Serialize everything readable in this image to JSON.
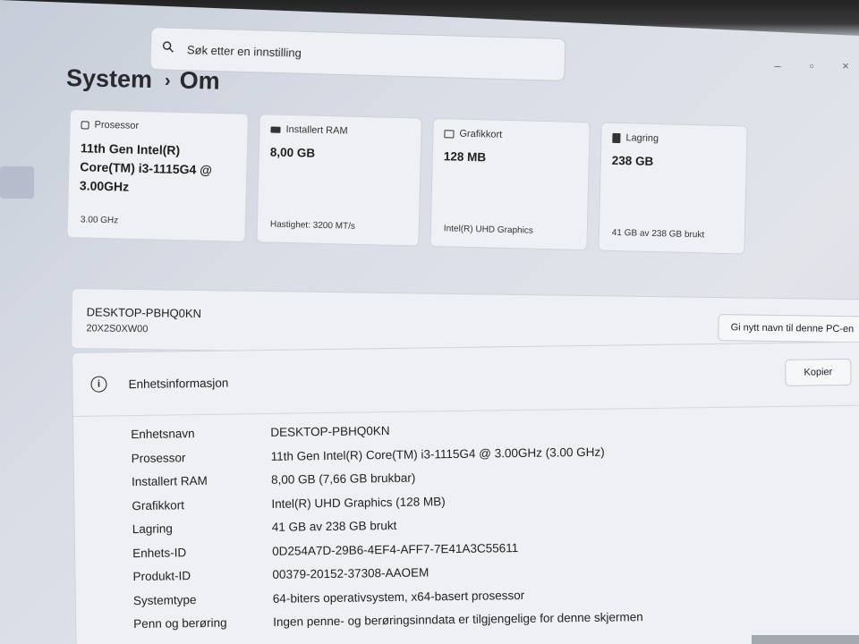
{
  "search": {
    "placeholder": "Søk etter en innstilling"
  },
  "breadcrumb": {
    "root": "System",
    "current": "Om"
  },
  "window_controls": {
    "minimize": "–",
    "maximize": "▫",
    "close": "×"
  },
  "cards": [
    {
      "id": "processor",
      "icon": "processor-icon",
      "label": "Prosessor",
      "value": "11th Gen Intel(R) Core(TM) i3-1115G4 @ 3.00GHz",
      "sub": "3.00 GHz"
    },
    {
      "id": "ram",
      "icon": "ram-icon",
      "label": "Installert RAM",
      "value": "8,00 GB",
      "sub": "Hastighet: 3200 MT/s"
    },
    {
      "id": "gpu",
      "icon": "gpu-icon",
      "label": "Grafikkort",
      "value": "128 MB",
      "sub": "Intel(R) UHD Graphics"
    },
    {
      "id": "storage",
      "icon": "storage-icon",
      "label": "Lagring",
      "value": "238 GB",
      "sub": "41 GB av 238 GB brukt"
    }
  ],
  "pc": {
    "name": "DESKTOP-PBHQ0KN",
    "model": "20X2S0XW00",
    "rename_label": "Gi nytt navn til denne PC-en"
  },
  "device_info": {
    "title": "Enhetsinformasjon",
    "copy_label": "Kopier",
    "rows": [
      {
        "key": "Enhetsnavn",
        "value": "DESKTOP-PBHQ0KN"
      },
      {
        "key": "Prosessor",
        "value": "11th Gen Intel(R) Core(TM) i3-1115G4 @ 3.00GHz (3.00 GHz)"
      },
      {
        "key": "Installert RAM",
        "value": "8,00 GB (7,66 GB brukbar)"
      },
      {
        "key": "Grafikkort",
        "value": "Intel(R) UHD Graphics (128 MB)"
      },
      {
        "key": "Lagring",
        "value": "41 GB av 238 GB brukt"
      },
      {
        "key": "Enhets-ID",
        "value": "0D254A7D-29B6-4EF4-AFF7-7E41A3C55611"
      },
      {
        "key": "Produkt-ID",
        "value": "00379-20152-37308-AAOEM"
      },
      {
        "key": "Systemtype",
        "value": "64-biters operativsystem, x64-basert prosessor"
      },
      {
        "key": "Penn og berøring",
        "value": "Ingen penne- og berøringsinndata er tilgjengelige for denne skjermen"
      }
    ]
  }
}
